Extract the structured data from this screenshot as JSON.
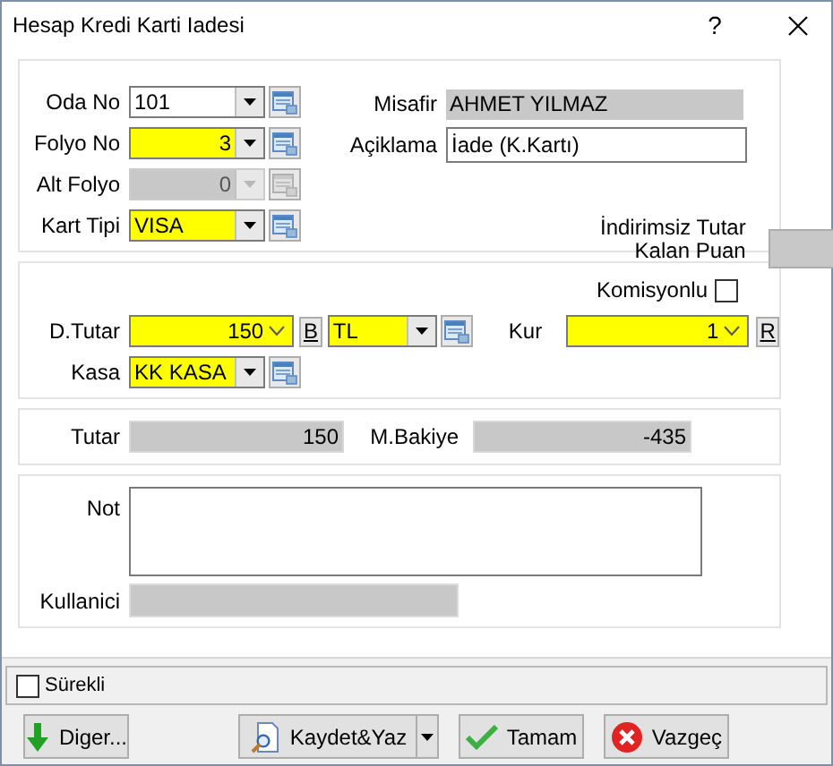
{
  "window": {
    "title": "Hesap Kredi Karti Iadesi",
    "help": "?"
  },
  "folio_panel": {
    "rows": [
      {
        "label": "Oda No",
        "value": "101",
        "kind": "text",
        "highlighted": false,
        "disabled": false
      },
      {
        "label": "Folyo No",
        "value": "3",
        "kind": "number",
        "highlighted": true,
        "disabled": false
      },
      {
        "label": "Alt Folyo",
        "value": "0",
        "kind": "number",
        "highlighted": false,
        "disabled": true
      },
      {
        "label": "Kart Tipi",
        "value": "VISA",
        "kind": "text",
        "highlighted": true,
        "disabled": false
      }
    ],
    "guest": {
      "label": "Misafir",
      "value": "AHMET YILMAZ"
    },
    "description": {
      "label": "Açiklama",
      "value": "İade (K.Kartı)"
    },
    "discount_label": "İndirimsiz Tutar",
    "points_label": "Kalan Puan"
  },
  "amount_panel": {
    "commission": {
      "label": "Komisyonlu",
      "checked": false
    },
    "amount": {
      "label": "D.Tutar",
      "value": "150",
      "highlighted": true
    },
    "b_button": "B",
    "currency": {
      "value": "TL",
      "highlighted": true
    },
    "rate": {
      "label": "Kur",
      "value": "1",
      "highlighted": true
    },
    "r_button": "R",
    "cash": {
      "label": "Kasa",
      "value": "KK KASA",
      "highlighted": true
    }
  },
  "totals_panel": {
    "total": {
      "label": "Tutar",
      "value": "150"
    },
    "balance": {
      "label": "M.Bakiye",
      "value": "-435"
    }
  },
  "note_panel": {
    "note": {
      "label": "Not"
    },
    "user": {
      "label": "Kullanici"
    }
  },
  "continuous": {
    "label": "Sürekli",
    "checked": false
  },
  "buttons": [
    {
      "label": "Diger...",
      "kind": "other"
    },
    {
      "label": "Kaydet&Yaz",
      "kind": "save_print"
    },
    {
      "label": "Tamam",
      "kind": "ok"
    },
    {
      "label": "Vazgeç",
      "kind": "cancel"
    }
  ]
}
